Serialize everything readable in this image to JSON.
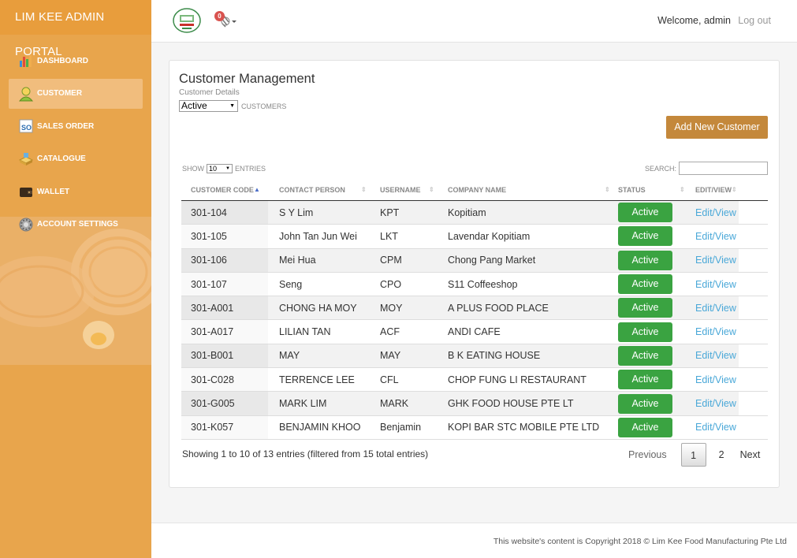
{
  "app": {
    "title": "LIM KEE ADMIN PORTAL"
  },
  "sidebar": {
    "items": [
      {
        "label": "DASHBOARD",
        "icon": "bar-chart-icon"
      },
      {
        "label": "CUSTOMER",
        "icon": "user-icon",
        "active": true
      },
      {
        "label": "SALES ORDER",
        "icon": "so-icon"
      },
      {
        "label": "CATALOGUE",
        "icon": "catalogue-icon"
      },
      {
        "label": "WALLET",
        "icon": "wallet-icon"
      },
      {
        "label": "ACCOUNT SETTINGS",
        "icon": "gear-icon"
      }
    ]
  },
  "topbar": {
    "notification_count": "0",
    "welcome": "Welcome, admin",
    "logout": "Log out"
  },
  "main": {
    "title": "Customer Management",
    "subtitle": "Customer Details",
    "status_filter": "Active",
    "customers_label": "CUSTOMERS",
    "add_button": "Add New Customer",
    "show_label": "SHOW",
    "entries_value": "10",
    "entries_label": "ENTRIES",
    "search_label": "SEARCH:",
    "columns": [
      "CUSTOMER CODE",
      "CONTACT PERSON",
      "USERNAME",
      "COMPANY NAME",
      "STATUS",
      "EDIT/VIEW"
    ],
    "rows": [
      {
        "code": "301-104",
        "contact": "S Y Lim",
        "username": "KPT",
        "company": "Kopitiam",
        "status": "Active",
        "action": "Edit/View"
      },
      {
        "code": "301-105",
        "contact": "John Tan Jun Wei",
        "username": "LKT",
        "company": "Lavendar Kopitiam",
        "status": "Active",
        "action": "Edit/View"
      },
      {
        "code": "301-106",
        "contact": "Mei Hua",
        "username": "CPM",
        "company": "Chong Pang Market",
        "status": "Active",
        "action": "Edit/View"
      },
      {
        "code": "301-107",
        "contact": "Seng",
        "username": "CPO",
        "company": "S11 Coffeeshop",
        "status": "Active",
        "action": "Edit/View"
      },
      {
        "code": "301-A001",
        "contact": "CHONG HA MOY",
        "username": "MOY",
        "company": "A PLUS FOOD PLACE",
        "status": "Active",
        "action": "Edit/View"
      },
      {
        "code": "301-A017",
        "contact": "LILIAN TAN",
        "username": "ACF",
        "company": "ANDI CAFE",
        "status": "Active",
        "action": "Edit/View"
      },
      {
        "code": "301-B001",
        "contact": "MAY",
        "username": "MAY",
        "company": "B K EATING HOUSE",
        "status": "Active",
        "action": "Edit/View"
      },
      {
        "code": "301-C028",
        "contact": "TERRENCE LEE",
        "username": "CFL",
        "company": "CHOP FUNG LI RESTAURANT",
        "status": "Active",
        "action": "Edit/View"
      },
      {
        "code": "301-G005",
        "contact": "MARK LIM",
        "username": "MARK",
        "company": "GHK FOOD HOUSE PTE LT",
        "status": "Active",
        "action": "Edit/View"
      },
      {
        "code": "301-K057",
        "contact": "BENJAMIN KHOO",
        "username": "Benjamin",
        "company": "KOPI BAR STC MOBILE PTE LTD",
        "status": "Active",
        "action": "Edit/View"
      }
    ],
    "info": "Showing 1 to 10 of 13 entries (filtered from 15 total entries)",
    "pagination": {
      "previous": "Previous",
      "pages": [
        "1",
        "2"
      ],
      "next": "Next"
    }
  },
  "footer": {
    "copyright": "This website's content is Copyright 2018 © Lim Kee Food Manufacturing Pte Ltd"
  },
  "colors": {
    "sidebar": "#e8a54c",
    "accent": "#c4883b",
    "active_green": "#3aa341",
    "link": "#4aa8d8"
  }
}
